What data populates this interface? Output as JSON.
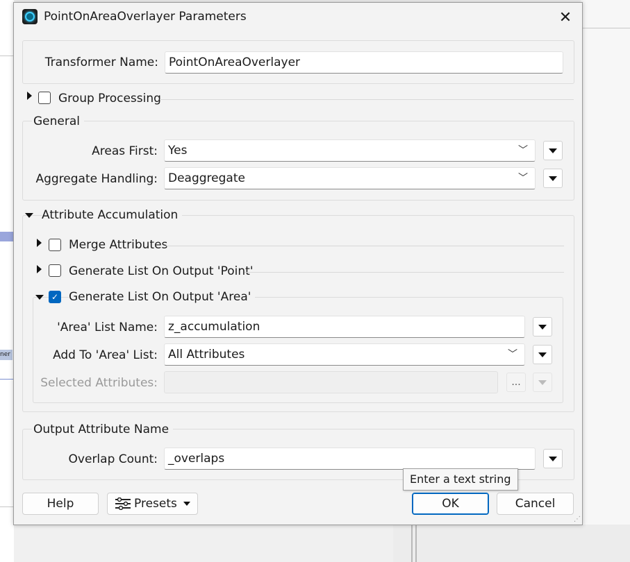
{
  "dialog": {
    "title": "PointOnAreaOverlayer Parameters",
    "close_icon": "close-icon",
    "transformer_name_label": "Transformer Name:",
    "transformer_name_value": "PointOnAreaOverlayer",
    "group_processing_label": "Group Processing"
  },
  "general": {
    "heading": "General",
    "areas_first_label": "Areas First:",
    "areas_first_value": "Yes",
    "aggregate_label": "Aggregate Handling:",
    "aggregate_value": "Deaggregate"
  },
  "accumulation": {
    "heading": "Attribute Accumulation",
    "merge_label": "Merge Attributes",
    "gen_point_label": "Generate List On Output 'Point'",
    "gen_area_label": "Generate List On Output 'Area'",
    "gen_area_checked": true,
    "list_name_label": "'Area' List Name:",
    "list_name_value": "z_accumulation",
    "add_to_label": "Add To 'Area' List:",
    "add_to_value": "All Attributes",
    "selected_label": "Selected Attributes:",
    "selected_value": "",
    "ellipsis": "..."
  },
  "output": {
    "heading": "Output Attribute Name",
    "overlap_label": "Overlap Count:",
    "overlap_value": "_overlaps"
  },
  "tooltip": "Enter a text string",
  "buttons": {
    "help": "Help",
    "presets": "Presets",
    "ok": "OK",
    "cancel": "Cancel"
  },
  "background": {
    "node_label": "ner"
  },
  "colors": {
    "accent": "#0067c0",
    "canvas_node": "#b9c6e0"
  }
}
